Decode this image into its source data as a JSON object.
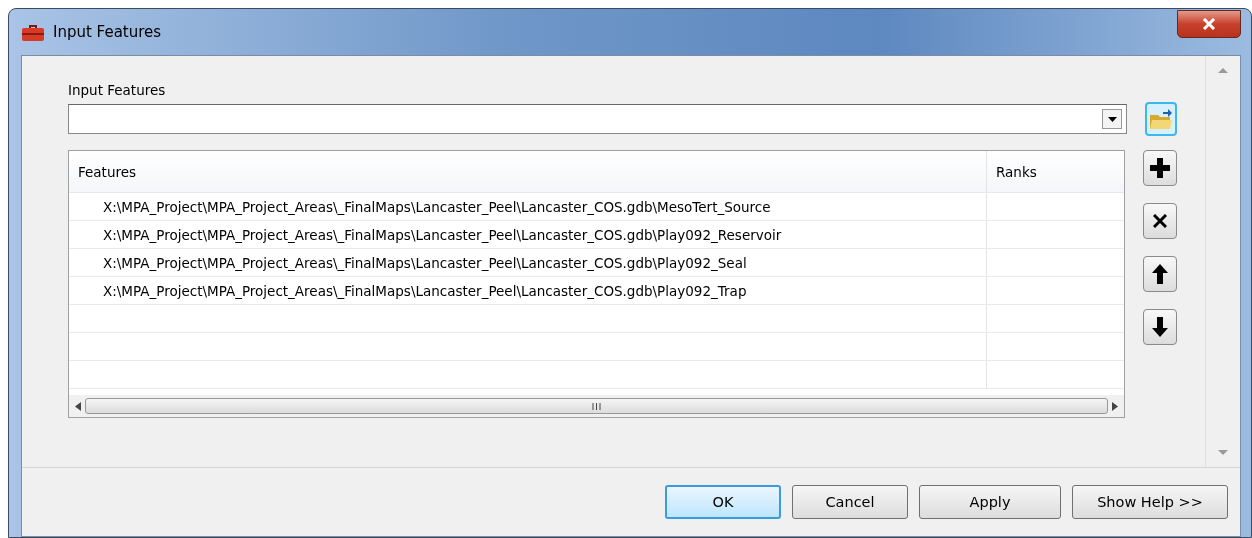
{
  "window": {
    "title": "Input Features"
  },
  "input_features": {
    "label": "Input Features"
  },
  "table": {
    "columns": [
      "Features",
      "Ranks"
    ],
    "rows": [
      {
        "feature": "X:\\MPA_Project\\MPA_Project_Areas\\_FinalMaps\\Lancaster_Peel\\Lancaster_COS.gdb\\MesoTert_Source"
      },
      {
        "feature": "X:\\MPA_Project\\MPA_Project_Areas\\_FinalMaps\\Lancaster_Peel\\Lancaster_COS.gdb\\Play092_Reservoir"
      },
      {
        "feature": "X:\\MPA_Project\\MPA_Project_Areas\\_FinalMaps\\Lancaster_Peel\\Lancaster_COS.gdb\\Play092_Seal"
      },
      {
        "feature": "X:\\MPA_Project\\MPA_Project_Areas\\_FinalMaps\\Lancaster_Peel\\Lancaster_COS.gdb\\Play092_Trap"
      }
    ]
  },
  "side_buttons": [
    {
      "kind": "add"
    },
    {
      "kind": "remove"
    },
    {
      "kind": "up"
    },
    {
      "kind": "down"
    }
  ],
  "buttons": [
    {
      "label": "OK",
      "default": true
    },
    {
      "label": "Cancel",
      "default": false
    },
    {
      "label": "Apply",
      "default": false
    },
    {
      "label": "Show Help >>",
      "default": false
    }
  ]
}
